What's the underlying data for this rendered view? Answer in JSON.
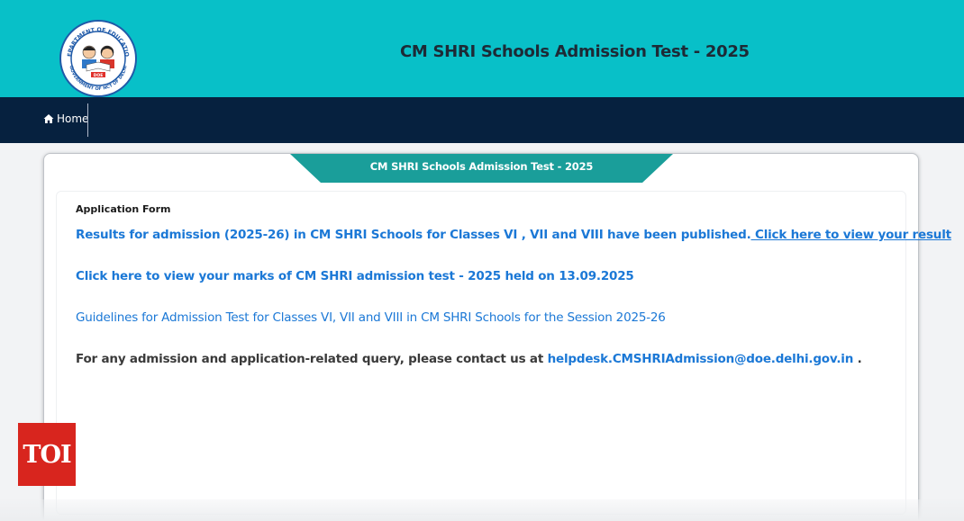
{
  "header": {
    "title": "CM SHRI Schools Admission Test - 2025",
    "logo_icon": "department-of-education-seal",
    "logo_text_top": "DEPARTMENT OF EDUCATION",
    "logo_text_bottom": "GOVERNMENT OF NCT OF DELHI",
    "logo_badge": "DOE"
  },
  "nav": {
    "home_label": "Home",
    "home_icon": "home-icon"
  },
  "card": {
    "tab_title": "CM SHRI Schools Admission Test - 2025",
    "form_heading": "Application Form",
    "results_text": "Results for admission (2025-26) in CM SHRI Schools for Classes VI , VII and VIII have been published.",
    "results_link": " Click here to view your result",
    "marks_link": "Click here to view your marks of CM SHRI admission test - 2025 held on 13.09.2025",
    "guidelines_link": "Guidelines for Admission Test for Classes VI, VII and VIII in CM SHRI Schools for the Session 2025-26",
    "contact_text": "For any admission and application-related query, please contact us at ",
    "contact_email": "helpdesk.CMSHRIAdmission@doe.delhi.gov.in",
    "contact_end": " ."
  },
  "watermark": {
    "label": "TOI"
  },
  "colors": {
    "header_bg": "#08c0c8",
    "nav_bg": "#06213f",
    "tab_bg": "#1a9e9a",
    "link": "#1b78d6",
    "toi_red": "#d8251e"
  }
}
